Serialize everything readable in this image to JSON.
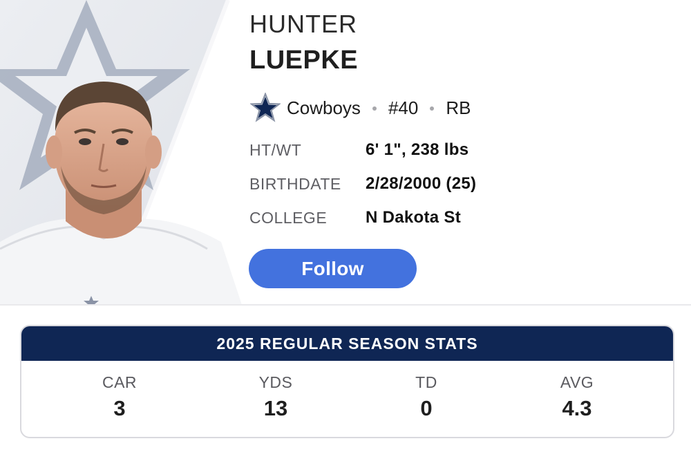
{
  "player": {
    "first_name": "HUNTER",
    "last_name": "LUEPKE",
    "team": "Cowboys",
    "number": "#40",
    "position": "RB"
  },
  "details": [
    {
      "label": "HT/WT",
      "value": "6' 1\", 238 lbs"
    },
    {
      "label": "BIRTHDATE",
      "value": "2/28/2000 (25)"
    },
    {
      "label": "COLLEGE",
      "value": "N Dakota St"
    }
  ],
  "actions": {
    "follow_label": "Follow"
  },
  "stats": {
    "title": "2025 REGULAR SEASON STATS",
    "items": [
      {
        "label": "CAR",
        "value": "3"
      },
      {
        "label": "YDS",
        "value": "13"
      },
      {
        "label": "TD",
        "value": "0"
      },
      {
        "label": "AVG",
        "value": "4.3"
      }
    ]
  },
  "colors": {
    "accent_button": "#4372de",
    "stats_header": "#0f2654",
    "team_star": "#0f2654"
  },
  "icons": {
    "team_logo": "cowboys-star-icon"
  }
}
